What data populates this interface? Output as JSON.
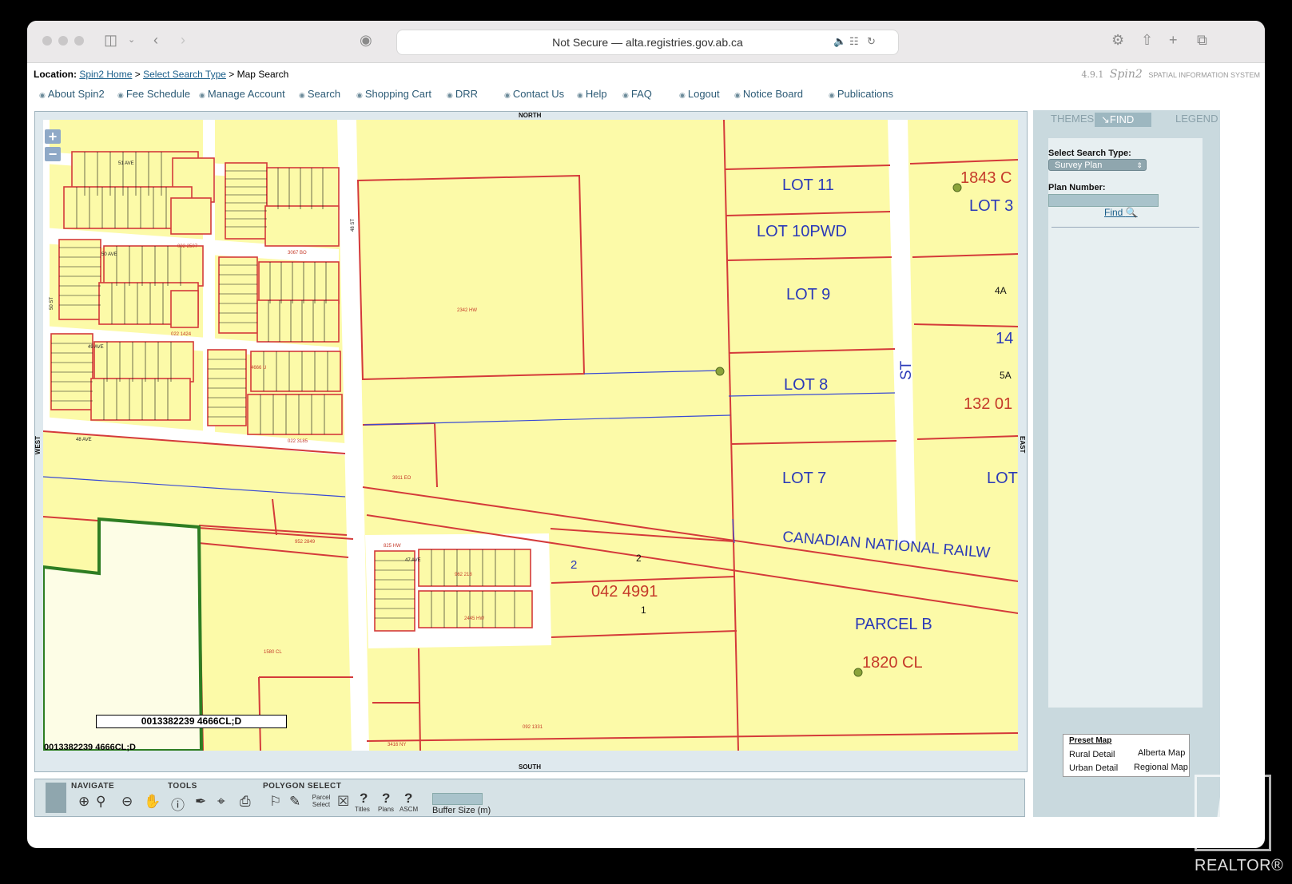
{
  "browser": {
    "url": "Not Secure — alta.registries.gov.ab.ca"
  },
  "header": {
    "location_label": "Location:",
    "crumbs": [
      "Spin2 Home",
      "Select Search Type",
      "Map Search"
    ],
    "separator": ">",
    "version": "4.9.1",
    "brand": "Spin2",
    "brand_sub": "SPATIAL INFORMATION SYSTEM"
  },
  "menu": [
    "About Spin2",
    "Fee Schedule",
    "Manage Account",
    "Search",
    "Shopping Cart",
    "DRR",
    "Contact Us",
    "Help",
    "FAQ",
    "Logout",
    "Notice Board",
    "Publications"
  ],
  "map": {
    "compass": {
      "north": "NORTH",
      "south": "SOUTH",
      "west": "WEST",
      "east": "EAST"
    },
    "zoom_in": "+",
    "zoom_out": "−",
    "labels": {
      "lot11": "LOT 11",
      "lot10": "LOT 10PWD",
      "lot9": "LOT 9",
      "lot8": "LOT 8",
      "lot7": "LOT 7",
      "lot3": "LOT 3",
      "lot_partial": "LOT",
      "plan1843": "1843 C",
      "n4a": "4A",
      "n14": "14",
      "n5a": "5A",
      "plan132": "132 01",
      "st": "ST",
      "railway": "CANADIAN NATIONAL RAILW",
      "parcel_b": "PARCEL B",
      "plan1820": "1820 CL",
      "plan042": "042 4991",
      "n2a": "2",
      "n2b": "2",
      "n1": "1",
      "ave51": "51 AVE",
      "ave50": "50 AVE",
      "ave49": "49 AVE",
      "ave48": "48 AVE",
      "ave47": "47 AVE",
      "st48": "48 ST",
      "st50": "50 ST",
      "p2342": "2342 HW",
      "p3911": "3911 EO",
      "p952": "952 2849",
      "p825": "825 HW",
      "p1580": "1580 CL",
      "p092": "092 1331",
      "p3416": "3416 NY",
      "p3067": "3067 BO",
      "p0022507": "002 2507",
      "p0221424": "022 1424",
      "p4666": "4666 U",
      "p0223185": "022 3185",
      "p2445": "2445 HW",
      "p962": "962 218"
    },
    "parcel_box": "0013382239 4666CL;D",
    "parcel_status": "0013382239 4666CL;D"
  },
  "toolbar": {
    "navigate": "NAVIGATE",
    "tools": "TOOLS",
    "polygon": "POLYGON SELECT",
    "parcel_select": "Parcel Select",
    "titles": "Titles",
    "plans": "Plans",
    "ascm": "ASCM",
    "buffer": "Buffer Size (m)"
  },
  "sidebar": {
    "tabs": [
      "THEMES",
      "FIND",
      "LEGEND"
    ],
    "search_type_label": "Select Search Type:",
    "search_type_value": "Survey Plan",
    "plan_number_label": "Plan Number:",
    "find_button": "Find",
    "preset_title": "Preset Map",
    "preset_items": [
      "Rural Detail",
      "Alberta Map",
      "Urban Detail",
      "Regional Map"
    ]
  },
  "watermark": "REALTOR®"
}
